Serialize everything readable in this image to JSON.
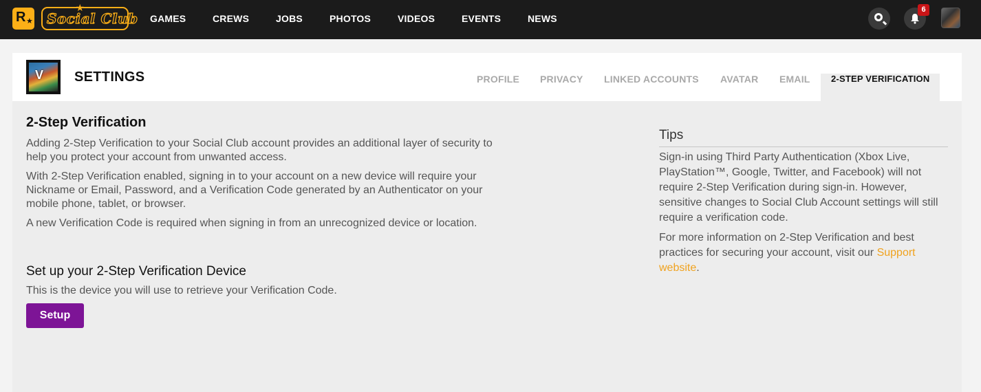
{
  "brand": {
    "rockstar_mark": "R",
    "social_club_logo": "Social Club",
    "accent": "#fcaf17"
  },
  "nav": [
    "GAMES",
    "CREWS",
    "JOBS",
    "PHOTOS",
    "VIDEOS",
    "EVENTS",
    "NEWS"
  ],
  "header_icons": {
    "search": "search-icon",
    "notifications": "bell-icon",
    "notification_count": "6"
  },
  "settings": {
    "title": "SETTINGS",
    "tabs": [
      "PROFILE",
      "PRIVACY",
      "LINKED ACCOUNTS",
      "AVATAR",
      "EMAIL",
      "2-STEP VERIFICATION"
    ],
    "active_tab": "2-STEP VERIFICATION"
  },
  "main": {
    "heading": "2-Step Verification",
    "paragraphs": [
      "Adding 2-Step Verification to your Social Club account provides an additional layer of security to help you protect your account from unwanted access.",
      "With 2-Step Verification enabled, signing in to your account on a new device will require your Nickname or Email, Password, and a Verification Code generated by an Authenticator on your mobile phone, tablet, or browser.",
      "A new Verification Code is required when signing in from an unrecognized device or location."
    ],
    "setup_heading": "Set up your 2-Step Verification Device",
    "setup_desc": "This is the device you will use to retrieve your Verification Code.",
    "setup_button": "Setup",
    "button_color": "#7d1496"
  },
  "tips": {
    "title": "Tips",
    "p1": "Sign-in using Third Party Authentication (Xbox Live, PlayStation™, Google, Twitter, and Facebook) will not require 2-Step Verification during sign-in. However, sensitive changes to Social Club Account settings will still require a verification code.",
    "p2_prefix": "For more information on 2-Step Verification and best practices for securing your account, visit our ",
    "p2_link": "Support website",
    "p2_suffix": ".",
    "link_color": "#f0a21e"
  }
}
